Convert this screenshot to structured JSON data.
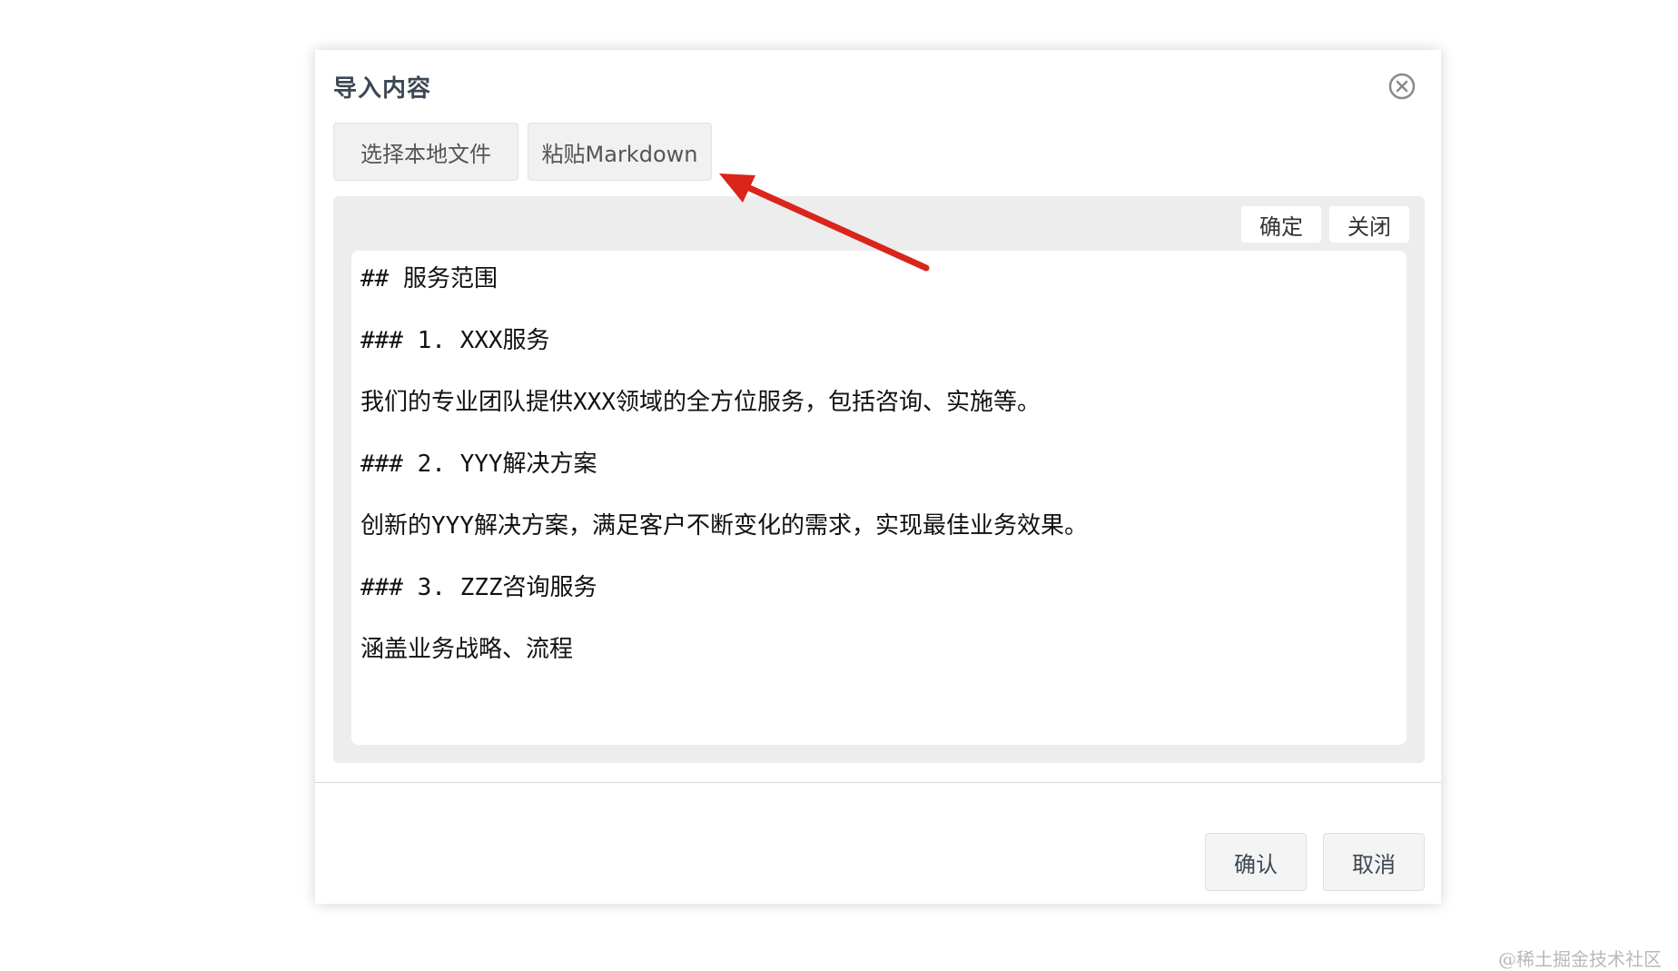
{
  "dialog": {
    "title": "导入内容",
    "close_icon": "close-circle-icon"
  },
  "tabs": {
    "local_file": "选择本地文件",
    "paste_markdown": "粘贴Markdown"
  },
  "panel": {
    "ok_label": "确定",
    "close_label": "关闭",
    "lines": [
      "## 服务范围",
      "### 1. XXX服务",
      "我们的专业团队提供XXX领域的全方位服务，包括咨询、实施等。",
      "### 2. YYY解决方案",
      "创新的YYY解决方案，满足客户不断变化的需求，实现最佳业务效果。",
      "### 3. ZZZ咨询服务",
      "涵盖业务战略、流程"
    ]
  },
  "footer": {
    "confirm_label": "确认",
    "cancel_label": "取消"
  },
  "annotation": {
    "arrow_color": "#d9251c"
  },
  "watermark": "@稀土掘金技术社区"
}
